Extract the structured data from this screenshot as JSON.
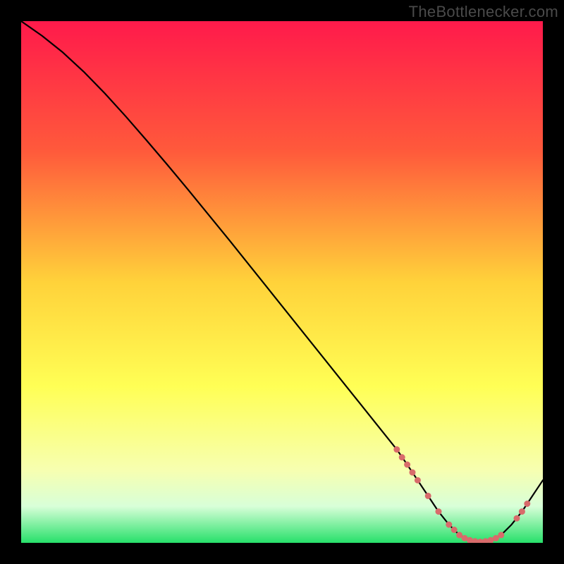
{
  "watermark": "TheBottlenecker.com",
  "chart_data": {
    "type": "line",
    "title": "",
    "xlabel": "",
    "ylabel": "",
    "xlim": [
      0,
      100
    ],
    "ylim": [
      0,
      100
    ],
    "gradient_stops": [
      {
        "offset": 0,
        "color": "#ff1a4b"
      },
      {
        "offset": 25,
        "color": "#ff5a3b"
      },
      {
        "offset": 50,
        "color": "#ffd23a"
      },
      {
        "offset": 70,
        "color": "#ffff55"
      },
      {
        "offset": 86,
        "color": "#f7ffb0"
      },
      {
        "offset": 93,
        "color": "#d8ffd8"
      },
      {
        "offset": 100,
        "color": "#27e06a"
      }
    ],
    "series": [
      {
        "name": "bottleneck-curve",
        "color": "#000000",
        "x": [
          0,
          4,
          8,
          12,
          16,
          20,
          24,
          28,
          32,
          36,
          40,
          44,
          48,
          52,
          56,
          60,
          64,
          68,
          72,
          74,
          76,
          78,
          80,
          82,
          84,
          86,
          88,
          90,
          92,
          94,
          96,
          98,
          100
        ],
        "y": [
          100,
          97.2,
          94.0,
          90.3,
          86.2,
          81.8,
          77.2,
          72.5,
          67.7,
          62.8,
          57.9,
          52.9,
          47.9,
          42.9,
          37.9,
          32.9,
          27.9,
          22.9,
          17.9,
          15.0,
          12.0,
          9.0,
          6.0,
          3.5,
          1.5,
          0.5,
          0.2,
          0.5,
          1.5,
          3.5,
          6.0,
          9.0,
          12.0
        ]
      }
    ],
    "markers": {
      "name": "highlight-dots",
      "color": "#d86b6b",
      "radius": 4.5,
      "points": [
        {
          "x": 72,
          "y": 17.9
        },
        {
          "x": 73,
          "y": 16.4
        },
        {
          "x": 74,
          "y": 15.0
        },
        {
          "x": 75,
          "y": 13.5
        },
        {
          "x": 76,
          "y": 12.0
        },
        {
          "x": 78,
          "y": 9.0
        },
        {
          "x": 80,
          "y": 6.0
        },
        {
          "x": 82,
          "y": 3.5
        },
        {
          "x": 83,
          "y": 2.5
        },
        {
          "x": 84,
          "y": 1.5
        },
        {
          "x": 85,
          "y": 0.9
        },
        {
          "x": 86,
          "y": 0.5
        },
        {
          "x": 87,
          "y": 0.3
        },
        {
          "x": 88,
          "y": 0.2
        },
        {
          "x": 89,
          "y": 0.3
        },
        {
          "x": 90,
          "y": 0.5
        },
        {
          "x": 91,
          "y": 0.9
        },
        {
          "x": 92,
          "y": 1.5
        },
        {
          "x": 95,
          "y": 4.7
        },
        {
          "x": 96,
          "y": 6.0
        },
        {
          "x": 97,
          "y": 7.5
        }
      ]
    }
  }
}
